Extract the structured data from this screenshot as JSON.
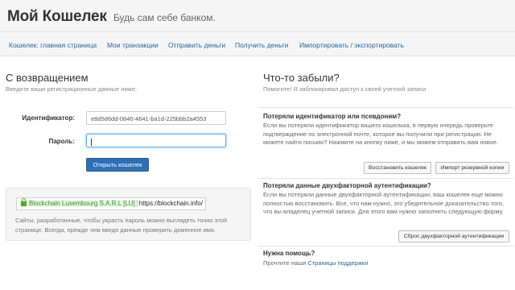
{
  "header": {
    "title": "Мой Кошелек",
    "tagline": "Будь сам себе банком."
  },
  "nav": {
    "items": [
      "Кошелек: главная страница",
      "Мои транзакции",
      "Отправить деньги",
      "Получить деньги",
      "Импортировать / экспортировать"
    ]
  },
  "login": {
    "heading": "С возвращением",
    "subtext": "Введите ваши регистрационные данные ниже:",
    "id_label": "Идентификатор:",
    "id_value": "e8d5d6dd-0840-4641-ba1d-225bbb2a4553",
    "password_label": "Пароль:",
    "password_value": "",
    "submit_label": "Открыть кошелек"
  },
  "security_notice": {
    "ev_name": "Blockchain Luxembourg S.A.R.L [LU]",
    "url": "https://blockchain.info/",
    "text": "Сайты, разработанные, чтобы украсть пароль можно выглядеть точно этой странице. Всегда, прежде чем введя данные проверить доменное имя."
  },
  "help": {
    "heading": "Что-то забыли?",
    "subtext": "Помогите! Я заблокировал доступ к своей учетной записи",
    "lost_id": {
      "title": "Потеряли идентификатор или псевдоним?",
      "body": "Если вы потеряли идентификатор вашего кошелька, в первую очередь проверьте подтверждение по электронной почте, которое вы получили при регистрации. Не можете найти письмо? Нажмите на кнопку ниже, и мы можем отправить вам новое.",
      "restore_button": "Восстановить кошелек",
      "import_backup_button": "Импорт резервной копии"
    },
    "lost_2fa": {
      "title": "Потеряли данные двухфакторной аутентификации?",
      "body": "Если вы потеряли данные двухфакторной аутентификации, ваш кошелек еще можно полностью восстановить. Все, что нам нужно, это убедительное доказательство того, что вы владелец учетной записи. Для этого вам нужно заполнить следующую форму.",
      "reset_button": "Сброс двухфакторной аутентификации"
    },
    "need_help": {
      "title": "Нужна помощь?",
      "prefix": "Прочтите наши",
      "link": "Страницы поддержки"
    }
  },
  "colors": {
    "link": "#2a6496",
    "primary_button": "#2f6fb5",
    "ev_green": "#2f8a2f"
  }
}
